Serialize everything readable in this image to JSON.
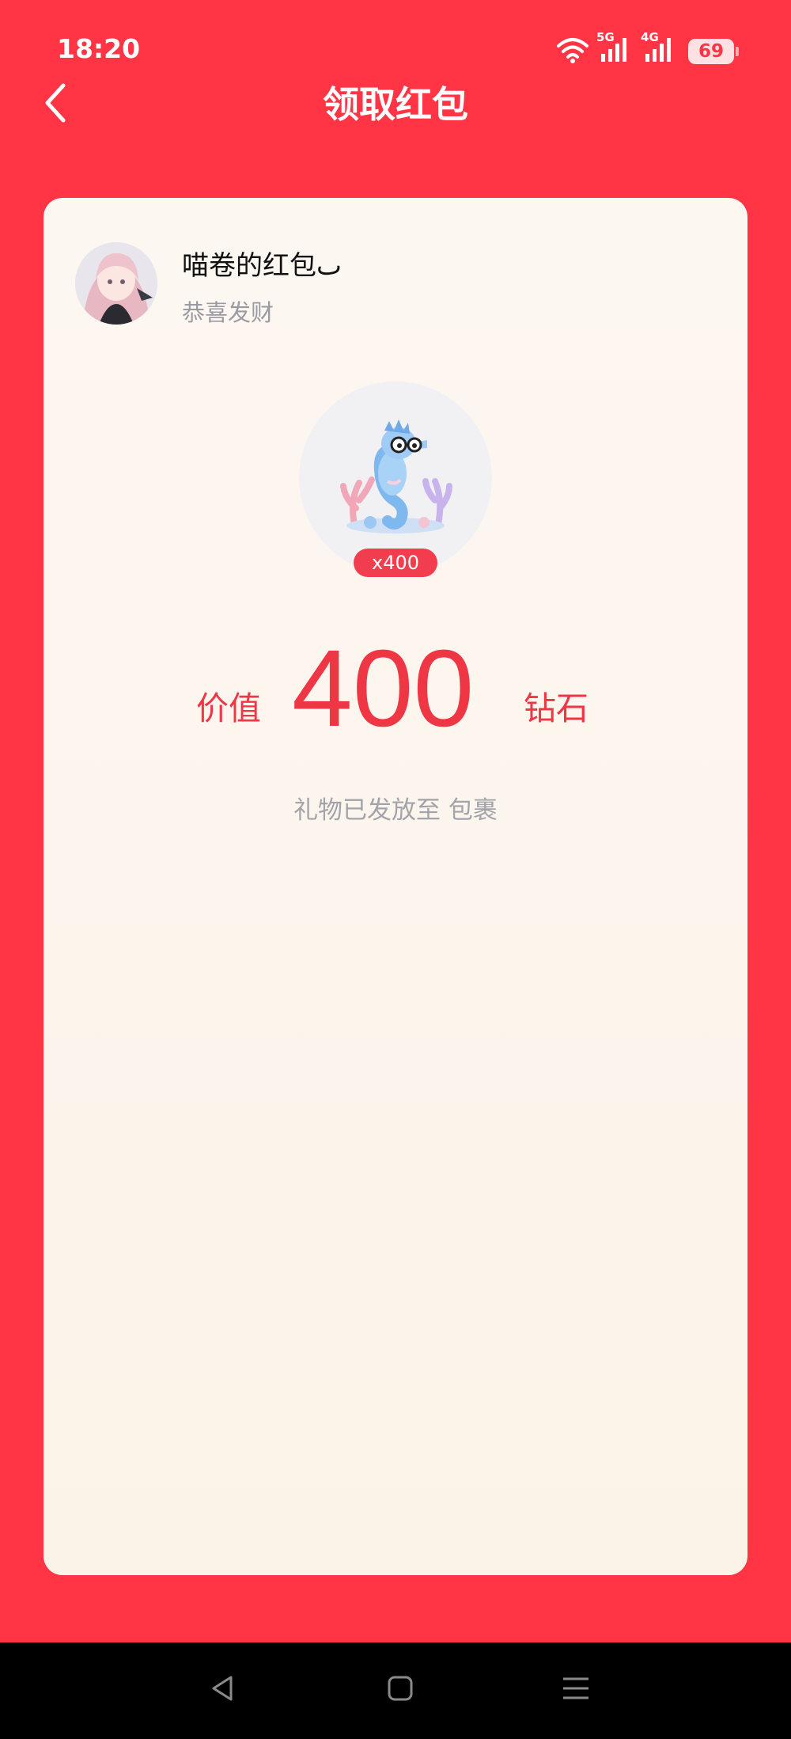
{
  "status_bar": {
    "time": "18:20",
    "network_1": "5G",
    "network_2": "4G",
    "battery": "69",
    "icons": [
      "wifi-icon",
      "signal-icon",
      "signal-icon",
      "battery-icon"
    ]
  },
  "header": {
    "title": "领取红包",
    "back_icon": "chevron-left-icon"
  },
  "card": {
    "sender_name": "喵卷的红包ٮ",
    "greeting": "恭喜发财",
    "gift_icon": "seahorse-gift-icon",
    "gift_count": "x400",
    "value_prefix": "价值",
    "value_amount": "400",
    "value_suffix": "钻石",
    "delivery_note": "礼物已发放至 包裹"
  },
  "nav_bar": {
    "buttons": [
      "back-triangle-icon",
      "home-square-icon",
      "menu-lines-icon"
    ]
  },
  "colors": {
    "background": "#FF3545",
    "card": "#FDF7F2",
    "accent": "#EE3645",
    "muted_text": "#A3A3AA"
  }
}
